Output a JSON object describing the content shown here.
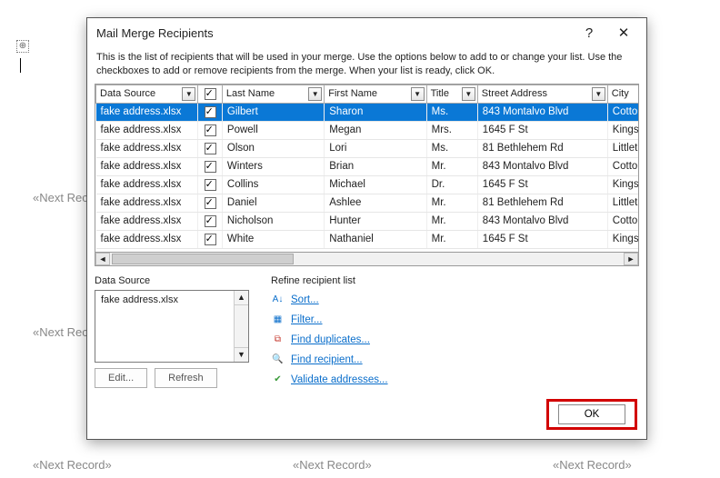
{
  "bg": {
    "next_record": "«Next Record»",
    "pilcrow": "⊕"
  },
  "dialog": {
    "title": "Mail Merge Recipients",
    "instructions": "This is the list of recipients that will be used in your merge.  Use the options below to add to or change your list. Use the checkboxes to add or remove recipients from the merge.  When your list is ready, click OK.",
    "columns": {
      "data_source": "Data Source",
      "last_name": "Last Name",
      "first_name": "First Name",
      "title": "Title",
      "street_address": "Street Address",
      "city": "City"
    },
    "rows": [
      {
        "ds": "fake address.xlsx",
        "chk": true,
        "ln": "Gilbert",
        "fn": "Sharon",
        "ti": "Ms.",
        "sa": "843 Montalvo Blvd",
        "ci": "Cotto",
        "sel": true
      },
      {
        "ds": "fake address.xlsx",
        "chk": true,
        "ln": "Powell",
        "fn": "Megan",
        "ti": "Mrs.",
        "sa": "1645 F St",
        "ci": "Kings"
      },
      {
        "ds": "fake address.xlsx",
        "chk": true,
        "ln": "Olson",
        "fn": "Lori",
        "ti": "Ms.",
        "sa": "81 Bethlehem Rd",
        "ci": "Littlet"
      },
      {
        "ds": "fake address.xlsx",
        "chk": true,
        "ln": "Winters",
        "fn": "Brian",
        "ti": "Mr.",
        "sa": "843 Montalvo Blvd",
        "ci": "Cotto"
      },
      {
        "ds": "fake address.xlsx",
        "chk": true,
        "ln": "Collins",
        "fn": "Michael",
        "ti": "Dr.",
        "sa": "1645 F St",
        "ci": "Kings"
      },
      {
        "ds": "fake address.xlsx",
        "chk": true,
        "ln": "Daniel",
        "fn": "Ashlee",
        "ti": "Mr.",
        "sa": "81 Bethlehem Rd",
        "ci": "Littlet"
      },
      {
        "ds": "fake address.xlsx",
        "chk": true,
        "ln": "Nicholson",
        "fn": "Hunter",
        "ti": "Mr.",
        "sa": "843 Montalvo Blvd",
        "ci": "Cotto"
      },
      {
        "ds": "fake address.xlsx",
        "chk": true,
        "ln": "White",
        "fn": "Nathaniel",
        "ti": "Mr.",
        "sa": "1645 F St",
        "ci": "Kings"
      }
    ],
    "data_source_panel": {
      "label": "Data Source",
      "item": "fake address.xlsx",
      "edit": "Edit...",
      "refresh": "Refresh"
    },
    "refine": {
      "label": "Refine recipient list",
      "sort": "Sort...",
      "filter": "Filter...",
      "dup": "Find duplicates...",
      "find": "Find recipient...",
      "validate": "Validate addresses..."
    },
    "ok": "OK"
  }
}
